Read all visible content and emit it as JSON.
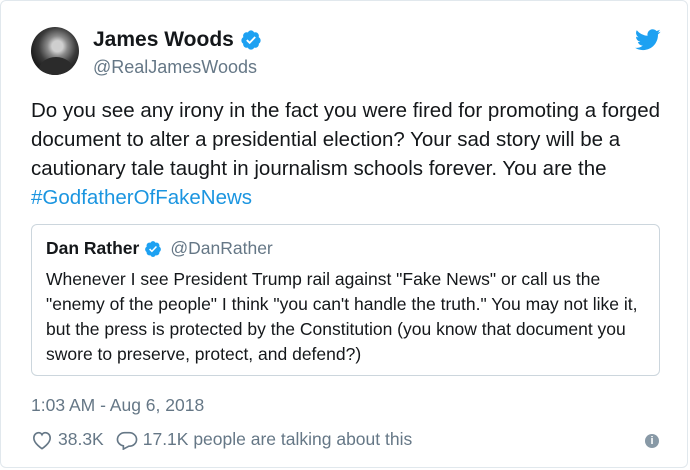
{
  "author": {
    "name": "James Woods",
    "handle": "@RealJamesWoods",
    "verified": true
  },
  "tweet": {
    "text": "Do you see any irony in the fact you were fired for promoting a forged document to alter a presidential election? Your sad story will be a cautionary tale taught in journalism schools forever. You are the ",
    "hashtag": "#GodfatherOfFakeNews"
  },
  "quoted": {
    "name": "Dan Rather",
    "handle": "@DanRather",
    "verified": true,
    "text": "Whenever I see President Trump rail against \"Fake News\" or call us the \"enemy of the people\" I think \"you can't handle the truth.\" You may not like it, but the press is protected by the Constitution (you know that document you swore to preserve, protect, and defend?)"
  },
  "timestamp": "1:03 AM - Aug 6, 2018",
  "stats": {
    "likes": "38.3K",
    "replies_label": "17.1K people are talking about this"
  },
  "icons": {
    "brand": "twitter-bird-icon",
    "verified": "verified-badge-icon",
    "like": "heart-icon",
    "reply": "speech-bubble-icon",
    "info": "info-icon"
  },
  "colors": {
    "brand": "#1da1f2",
    "link": "#1b95e0",
    "muted": "#657786",
    "border": "#e1e8ed"
  }
}
